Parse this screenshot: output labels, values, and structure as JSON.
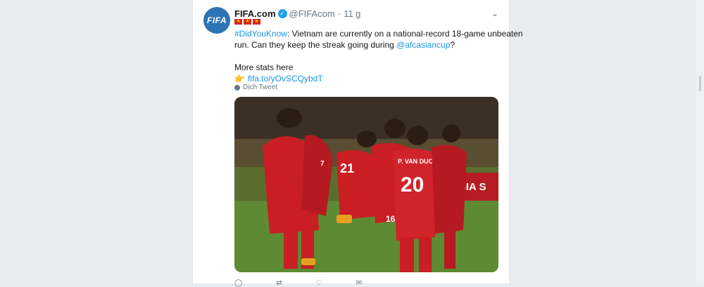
{
  "tweet": {
    "display_name": "FIFA.com",
    "handle": "@FIFAcom",
    "separator": "·",
    "time": "11 g",
    "avatar_text": "FIFA",
    "hashtag": "#DidYouKnow",
    "text_part1": ": Vietnam are currently on a national-record 18-game unbeaten",
    "text_part2": "run. Can they keep the streak going during ",
    "mention": "@afcasiancup",
    "text_part3": "?",
    "more_stats": "More stats here",
    "emoji": "👉",
    "link": "fifa.to/yOvSCQybdT",
    "translate": "Dịch Tweet",
    "flag_glyph": "★"
  },
  "media": {
    "jersey_left": "21",
    "jersey_name": "P. VAN DUC",
    "jersey_number": "20",
    "banner_text": "BIA S",
    "jersey_back": "16",
    "jersey_shorts": "7"
  },
  "actions": {
    "reply_icon": "reply-icon",
    "retweet_icon": "retweet-icon",
    "like_icon": "heart-icon",
    "message_icon": "message-icon"
  },
  "colors": {
    "link": "#1b95e0",
    "verified": "#1da1f2",
    "jersey": "#c81e24",
    "avatar": "#2c74b3"
  }
}
